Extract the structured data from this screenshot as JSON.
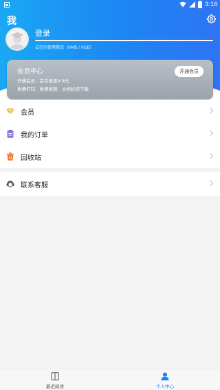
{
  "status_bar": {
    "time": "3:16"
  },
  "header": {
    "title": "我"
  },
  "profile": {
    "login_label": "登录",
    "storage_text": "云空间使用情况（0MB / 0GB）"
  },
  "member_card": {
    "title": "会员中心",
    "line1": "开通会员，首月低至9.9元",
    "line2": "免费打印、免费复制、文档折扣下载",
    "button_label": "开通会员"
  },
  "menu": {
    "items": [
      {
        "label": "会员",
        "icon": "diamond-icon"
      },
      {
        "label": "我的订单",
        "icon": "order-clipboard-icon"
      },
      {
        "label": "回收站",
        "icon": "trash-icon"
      }
    ],
    "support": {
      "label": "联系客服",
      "icon": "customer-service-icon"
    }
  },
  "bottom_nav": {
    "items": [
      {
        "label": "最近阅读",
        "icon": "book-icon"
      },
      {
        "label": "个人中心",
        "icon": "person-icon",
        "active": true
      }
    ]
  },
  "colors": {
    "accent": "#1f85f3",
    "member_gold": "#f5b630",
    "order_purple": "#8b74e8",
    "trash_orange": "#f26d21"
  }
}
